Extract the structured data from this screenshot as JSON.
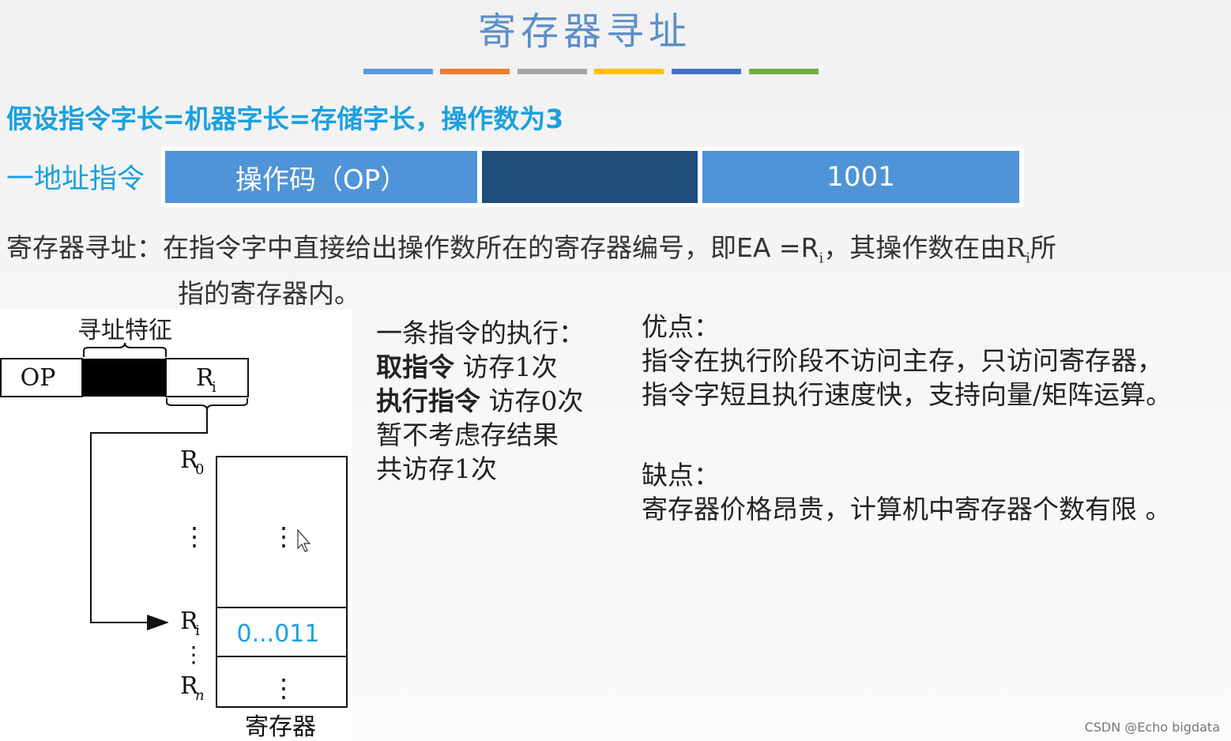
{
  "title": "寄存器寻址",
  "accent_bars": [
    "#5b9bd5",
    "#ed7d31",
    "#a5a5a5",
    "#ffc000",
    "#4472c4",
    "#70ad47"
  ],
  "assumption": "假设指令字长=机器字长=存储字长，操作数为3",
  "instruction": {
    "label": "一地址指令",
    "opcode": "操作码（OP）",
    "middle": "",
    "address": "1001",
    "colors": {
      "light": "#4f94d8",
      "dark": "#1f4e7c"
    }
  },
  "definition": {
    "prefix": "寄存器寻址：在指令字中直接给出操作数所在的寄存器编号，即",
    "ea": "EA =R",
    "ea_sub": "i",
    "mid": "，其操作数在由R",
    "mid_sub": "i",
    "suffix": "所",
    "line2": "指的寄存器内。"
  },
  "diagram": {
    "feature_label": "寻址特征",
    "op": "OP",
    "ri": "R",
    "ri_sub": "i",
    "r0": "R",
    "r0_sub": "0",
    "rn": "R",
    "rn_sub": "n",
    "reg_value": "0...011",
    "reg_caption": "寄存器",
    "dots": "⋮"
  },
  "execution": {
    "heading": "一条指令的执行：",
    "fetch_bold": "取指令",
    "fetch_rest": " 访存1次",
    "exec_bold": "执行指令",
    "exec_rest": " 访存0次",
    "note": "暂不考虑存结果",
    "total": "共访存1次"
  },
  "pros": {
    "heading": "优点：",
    "line1": "指令在执行阶段不访问主存，只访问寄存器，",
    "line2": "指令字短且执行速度快，支持向量/矩阵运算。"
  },
  "cons": {
    "heading": "缺点：",
    "line1": "寄存器价格昂贵，计算机中寄存器个数有限 。"
  },
  "watermark": "CSDN @Echo bigdata"
}
